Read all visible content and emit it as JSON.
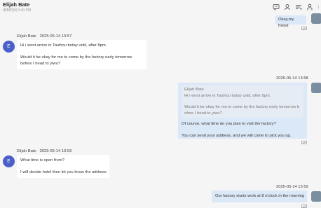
{
  "header": {
    "name": "Elijah Bate",
    "status": "未知时间 3:40 PM"
  },
  "header_icons": [
    "chat-icon",
    "contact-icon",
    "list-icon",
    "person-icon",
    "more-icon"
  ],
  "messages": [
    {
      "direction": "out",
      "text": "Okay,my friend"
    },
    {
      "direction": "in",
      "sender": "Elijah Bate",
      "time": "2025-05-14 13:57",
      "avatar_letter": "E",
      "line1": "Hi i wont arrive in Taizhou today until, after 8pm.",
      "line2": "Would it be okay for me to come by the factory early tomorrow",
      "line3": "before I head to yiwu?"
    },
    {
      "direction": "out",
      "time": "2025-05-14 13:58",
      "quote_name": "Elijah Bate",
      "quote1": "Hi i wont arrive in Taizhou today until, after 8pm.",
      "quote2": "Would it be okay for me to come by the factory early tomorrow b",
      "quote3": "efore I head to yiwu?",
      "line1": "Of course, what time do you plan to visit the factory?",
      "line2": "You can send your address, and we will come to pick you up."
    },
    {
      "direction": "in",
      "sender": "Elijah Bate",
      "time": "2025-05-14 13:59",
      "avatar_letter": "E",
      "line1": "What time is open from?",
      "line2": "I will decide hotel then let you know the address"
    },
    {
      "direction": "out",
      "time": "2025-05-14 13:59",
      "text": "Our factory starts work at 8 o'clock in the morning"
    }
  ],
  "colors": {
    "accent": "#4a5fc9",
    "out_bubble": "#dbe8f8",
    "in_bubble": "#ffffff"
  }
}
